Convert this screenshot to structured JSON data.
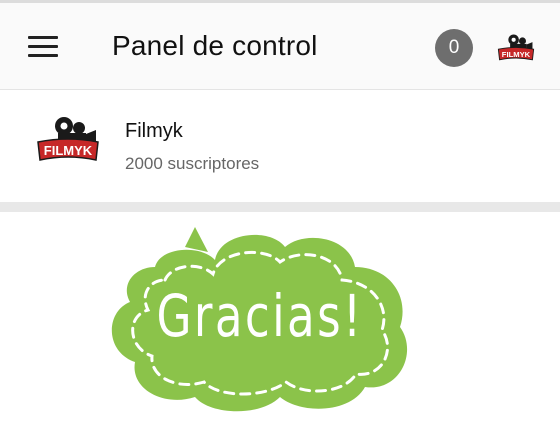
{
  "header": {
    "title": "Panel de control",
    "notification_count": "0",
    "menu_icon": "hamburger-menu-icon",
    "account_avatar_text": "FILMYK"
  },
  "channel": {
    "name": "Filmyk",
    "subscribers": "2000 suscriptores",
    "logo_text": "FILMYK"
  },
  "graphic": {
    "text": "Gracias!",
    "color": "#8bc34a"
  },
  "colors": {
    "badge": "#6e6e6e",
    "logo_red": "#c62828"
  }
}
